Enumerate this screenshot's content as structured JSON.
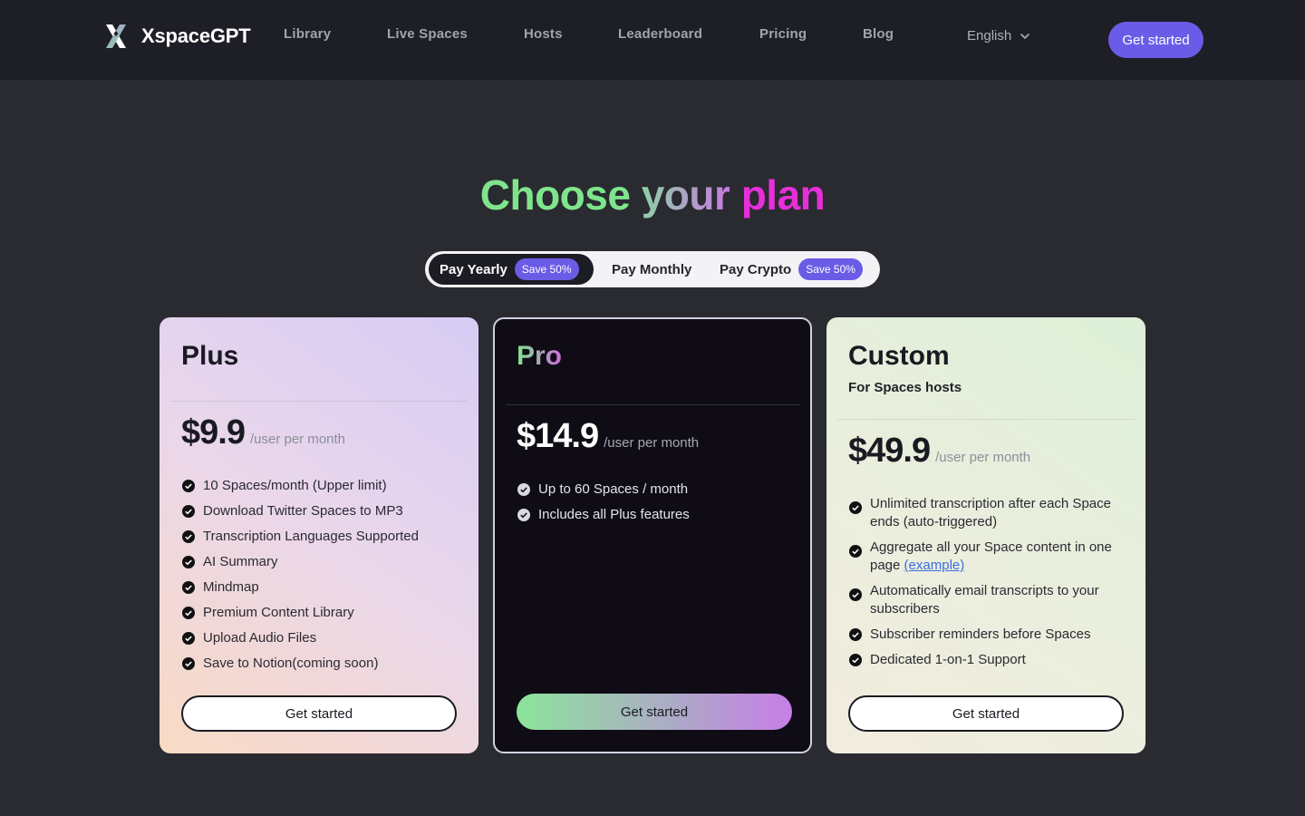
{
  "nav": {
    "brand": "XspaceGPT",
    "links": [
      "Library",
      "Live Spaces",
      "Hosts",
      "Leaderboard",
      "Pricing",
      "Blog"
    ],
    "language": "English",
    "cta": "Get started"
  },
  "hero": {
    "title_1": "Choose",
    "title_2": "your",
    "title_3": "plan"
  },
  "toggle": {
    "yearly": "Pay Yearly",
    "yearly_badge": "Save 50%",
    "monthly": "Pay Monthly",
    "crypto": "Pay Crypto",
    "crypto_badge": "Save 50%"
  },
  "plans": [
    {
      "name": "Plus",
      "price": "$9.9",
      "unit": "/user per month",
      "features": [
        "10 Spaces/month (Upper limit)",
        "Download Twitter Spaces to MP3",
        "Transcription Languages Supported",
        "AI Summary",
        "Mindmap",
        "Premium Content Library",
        "Upload Audio Files",
        "Save to Notion(coming soon)"
      ],
      "cta": "Get started"
    },
    {
      "name": "Pro",
      "price": "$14.9",
      "unit": "/user per month",
      "features": [
        "Up to 60 Spaces / month",
        "Includes all Plus features"
      ],
      "cta": "Get started"
    },
    {
      "name": "Custom",
      "subtitle": "For Spaces hosts",
      "price": "$49.9",
      "unit": "/user per month",
      "features": [
        "Unlimited transcription after each Space ends (auto-triggered)",
        "Aggregate all your Space content in one page",
        "Automatically email transcripts to your subscribers",
        "Subscriber reminders before Spaces",
        "Dedicated 1-on-1 Support"
      ],
      "feature_link": "(example)",
      "cta": "Get started"
    }
  ],
  "colors": {
    "background": "#2a2a31",
    "nav_background": "#1e1e26",
    "accent": "#6b5ce7",
    "title_green": "#7ee58c",
    "title_pink": "#e62fd8",
    "link": "#3b6fe0"
  }
}
